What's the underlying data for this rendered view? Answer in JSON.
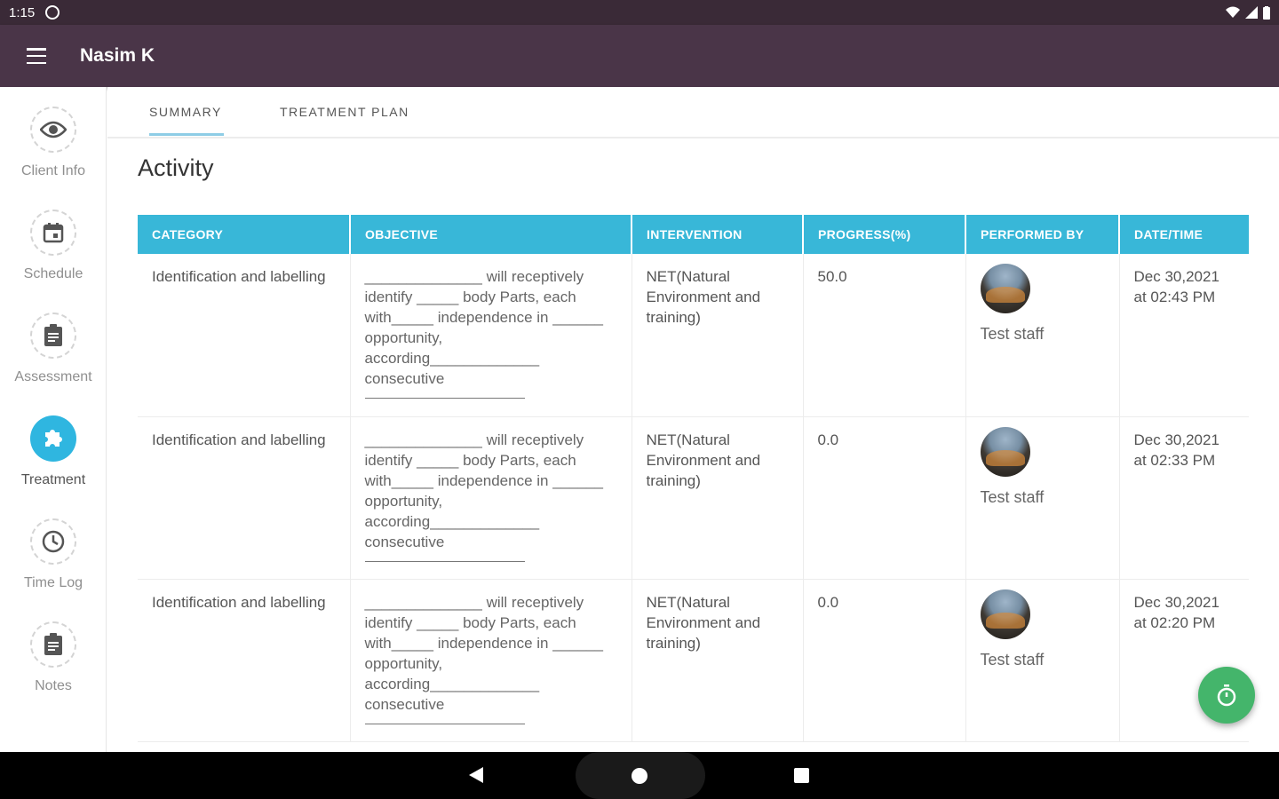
{
  "status_bar": {
    "time": "1:15"
  },
  "app_bar": {
    "title": "Nasim K"
  },
  "sidebar": {
    "items": [
      {
        "label": "Client Info",
        "icon": "eye-icon"
      },
      {
        "label": "Schedule",
        "icon": "calendar-icon"
      },
      {
        "label": "Assessment",
        "icon": "clipboard-icon"
      },
      {
        "label": "Treatment",
        "icon": "puzzle-icon",
        "active": true
      },
      {
        "label": "Time Log",
        "icon": "clock-icon"
      },
      {
        "label": "Notes",
        "icon": "clipboard-icon"
      }
    ]
  },
  "tabs": [
    {
      "label": "SUMMARY",
      "active": true
    },
    {
      "label": "TREATMENT PLAN"
    }
  ],
  "section_title": "Activity",
  "table": {
    "columns": [
      "CATEGORY",
      "OBJECTIVE",
      "INTERVENTION",
      "PROGRESS(%)",
      "PERFORMED BY",
      "DATE/TIME"
    ],
    "rows": [
      {
        "category": "Identification and labelling",
        "objective": "______________ will receptively identify _____ body Parts, each with_____ independence in ______ opportunity, according_____________ consecutive",
        "intervention": "NET(Natural Environment and training)",
        "progress": "50.0",
        "performed_by": "Test staff",
        "datetime": "Dec 30,2021 at 02:43 PM"
      },
      {
        "category": "Identification and labelling",
        "objective": "______________ will receptively identify _____ body Parts, each with_____ independence in ______ opportunity, according_____________ consecutive",
        "intervention": "NET(Natural Environment and training)",
        "progress": "0.0",
        "performed_by": "Test staff",
        "datetime": "Dec 30,2021 at 02:33 PM"
      },
      {
        "category": "Identification and labelling",
        "objective": "______________ will receptively identify _____ body Parts, each with_____ independence in ______ opportunity, according_____________ consecutive",
        "intervention": "NET(Natural Environment and training)",
        "progress": "0.0",
        "performed_by": "Test staff",
        "datetime": "Dec 30,2021 at 02:20 PM"
      }
    ]
  },
  "colors": {
    "appbar": "#4a3548",
    "header": "#38b7d8",
    "active": "#2fb6e0",
    "fab": "#44b56b"
  }
}
